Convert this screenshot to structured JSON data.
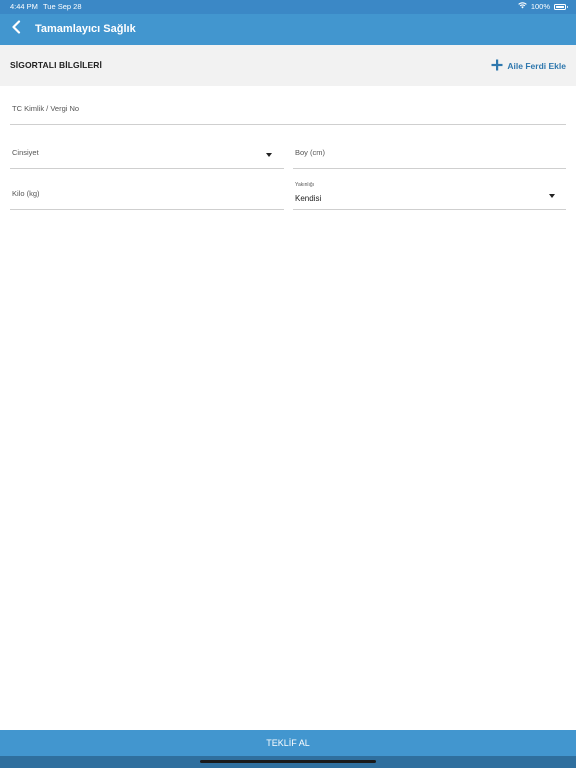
{
  "status_bar": {
    "time": "4:44 PM",
    "date": "Tue Sep 28",
    "battery": "100%",
    "icons": [
      "wifi-icon",
      "battery-icon"
    ]
  },
  "navbar": {
    "back_icon": "chevron-left-icon",
    "title": "Tamamlayıcı Sağlık"
  },
  "section": {
    "title": "SİGORTALI BİLGİLERİ",
    "add_member_icon": "plus-icon",
    "add_member_label": "Aile Ferdi Ekle"
  },
  "form": {
    "tc_vergi": {
      "placeholder": "TC Kimlik / Vergi No",
      "value": ""
    },
    "cinsiyet": {
      "placeholder": "Cinsiyet",
      "selected": ""
    },
    "boy": {
      "placeholder": "Boy (cm)",
      "value": ""
    },
    "kilo": {
      "placeholder": "Kilo (kg)",
      "value": ""
    },
    "yakinlik": {
      "label": "Yakınlığı",
      "selected": "Kendisi"
    }
  },
  "footer": {
    "submit_label": "TEKLİF AL"
  },
  "colors": {
    "primary": "#4296cf",
    "status_bar": "#3b88c6",
    "link": "#2f78ae",
    "section_bg": "#f2f2f2"
  }
}
